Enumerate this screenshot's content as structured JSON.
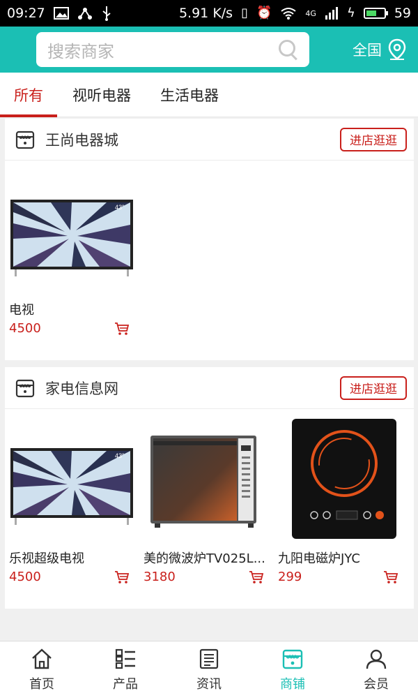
{
  "status_bar": {
    "time": "09:27",
    "speed": "5.91 K/s",
    "network": "4G",
    "battery_level": "59",
    "battery_fraction": 0.59,
    "left_icons": [
      "image-icon",
      "share-icon",
      "usb-icon"
    ],
    "right_icons": [
      "vibrate-icon",
      "alarm-icon",
      "wifi-icon",
      "signal-icon",
      "charging-icon"
    ]
  },
  "header": {
    "search_placeholder": "搜索商家",
    "region_label": "全国",
    "accent_color": "#1bbfb4"
  },
  "tabs": [
    {
      "label": "所有",
      "active": true
    },
    {
      "label": "视听电器",
      "active": false
    },
    {
      "label": "生活电器",
      "active": false
    }
  ],
  "shops": [
    {
      "name": "王尚电器城",
      "enter_label": "进店逛逛",
      "products": [
        {
          "name": "电视",
          "price": "4500",
          "image": "tv"
        }
      ]
    },
    {
      "name": "家电信息网",
      "enter_label": "进店逛逛",
      "products": [
        {
          "name": "乐视超级电视",
          "price": "4500",
          "image": "tv"
        },
        {
          "name": "美的微波炉TV025L...",
          "price": "3180",
          "image": "microwave"
        },
        {
          "name": "九阳电磁炉JYC",
          "price": "299",
          "image": "induction-cooker"
        }
      ]
    }
  ],
  "bottom_nav": [
    {
      "label": "首页",
      "icon": "home-icon",
      "active": false
    },
    {
      "label": "产品",
      "icon": "list-icon",
      "active": false
    },
    {
      "label": "资讯",
      "icon": "news-icon",
      "active": false
    },
    {
      "label": "商铺",
      "icon": "store-icon",
      "active": true
    },
    {
      "label": "会员",
      "icon": "user-icon",
      "active": false
    }
  ],
  "colors": {
    "primary_red": "#c9201c",
    "teal": "#1bbfb4"
  }
}
